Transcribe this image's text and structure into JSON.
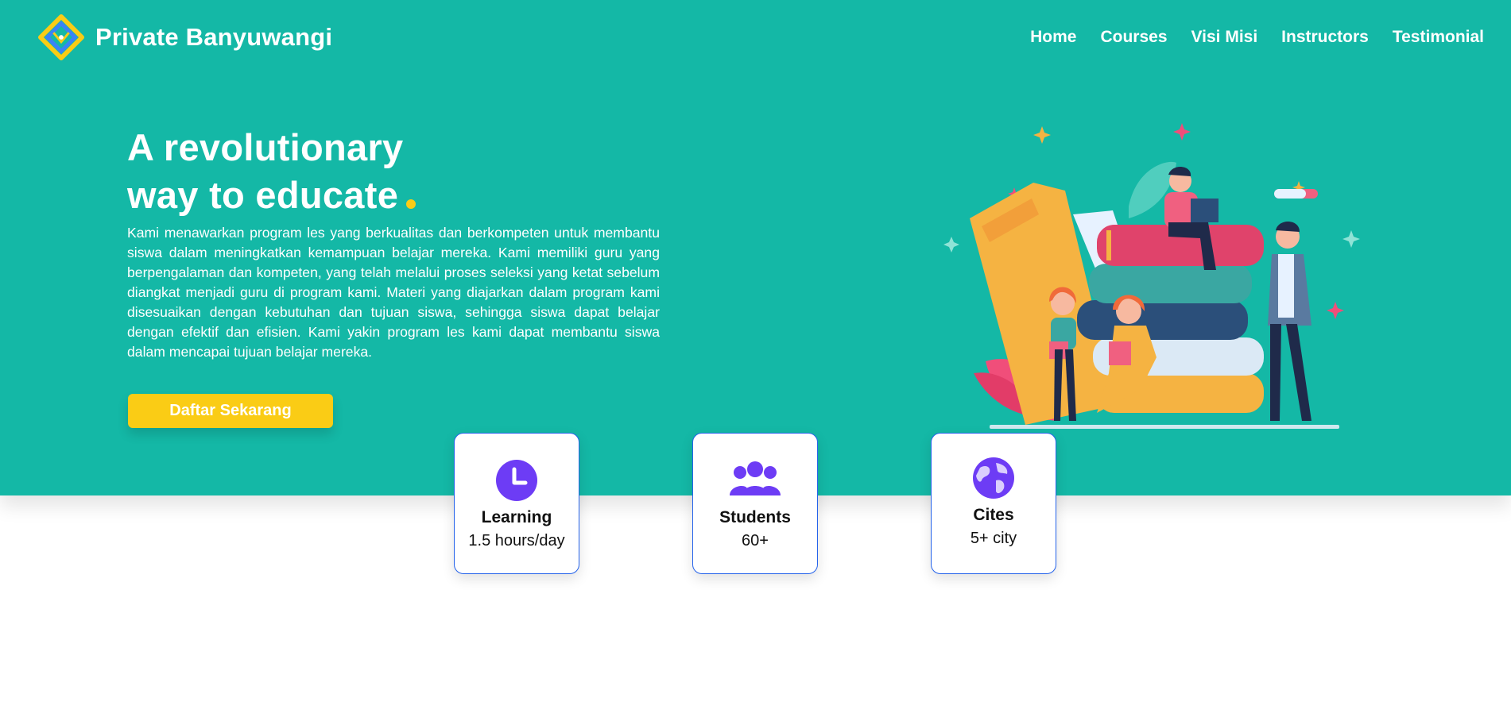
{
  "brand": {
    "name": "Private Banyuwangi",
    "logo_icon": "diamond-logo-icon"
  },
  "nav": {
    "items": [
      "Home",
      "Courses",
      "Visi Misi",
      "Instructors",
      "Testimonial"
    ]
  },
  "hero": {
    "headline_line1": "A revolutionary",
    "headline_line2": "way to educate",
    "description": "Kami menawarkan program les yang berkualitas dan berkompeten untuk membantu siswa dalam meningkatkan kemampuan belajar mereka. Kami memiliki guru yang berpengalaman dan kompeten, yang telah melalui proses seleksi yang ketat sebelum diangkat menjadi guru di program kami. Materi yang diajarkan dalam program kami disesuaikan dengan kebutuhan dan tujuan siswa, sehingga siswa dapat belajar dengan efektif dan efisien. Kami yakin program les kami dapat membantu siswa dalam mencapai tujuan belajar mereka.",
    "cta_label": "Daftar Sekarang"
  },
  "stats": [
    {
      "label": "Learning",
      "value": "1.5 hours/day",
      "icon": "clock-icon"
    },
    {
      "label": "Students",
      "value": "60+",
      "icon": "users-icon"
    },
    {
      "label": "Cites",
      "value": "5+ city",
      "icon": "globe-icon"
    }
  ],
  "colors": {
    "primary": "#14b8a6",
    "accent": "#facc15",
    "icon": "#6d3cf5",
    "card_border": "#2563eb"
  }
}
